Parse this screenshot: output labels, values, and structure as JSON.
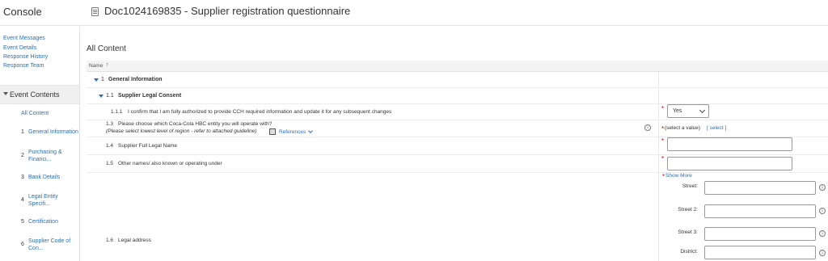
{
  "header": {
    "console_title": "Console",
    "doc_title": "Doc1024169835 - Supplier registration questionnaire"
  },
  "sidebar": {
    "links": [
      "Event Messages",
      "Event Details",
      "Response History",
      "Response Team"
    ],
    "section_label": "Event Contents",
    "all_content": "All Content",
    "toc": [
      {
        "num": "1",
        "label": "General Information"
      },
      {
        "num": "2",
        "label": "Purchasing & Financi..."
      },
      {
        "num": "3",
        "label": "Bank Details"
      },
      {
        "num": "4",
        "label": "Legal Entity Specifi..."
      },
      {
        "num": "5",
        "label": "Certification"
      },
      {
        "num": "6",
        "label": "Supplier Code of Con..."
      }
    ]
  },
  "main": {
    "title": "All Content",
    "column_name": "Name",
    "sort_indicator": "↑",
    "section1": {
      "num": "1",
      "label": "General Information"
    },
    "section11": {
      "num": "1.1",
      "label": "Supplier Legal Consent"
    },
    "q111": {
      "num": "1.1.1",
      "text": "I confirm that I am fully authorized to provide CCH required information and update it for any subsequent changes",
      "value": "Yes"
    },
    "q13": {
      "num": "1.3",
      "text": "Please choose which Coca-Cola HBC entity you will operate with?",
      "hint": "(Please select lowest level of region - refer to attached guideline)",
      "references": "References",
      "placeholder": "(select a value)",
      "select_link": "[ select ]"
    },
    "q14": {
      "num": "1.4",
      "text": "Supplier Full Legal Name"
    },
    "q15": {
      "num": "1.5",
      "text": "Other names/ also known or operating under"
    },
    "show_more": "Show More",
    "q16": {
      "num": "1.6",
      "text": "Legal address",
      "fields": [
        "Street:",
        "Street 2:",
        "Street 3:",
        "District:"
      ]
    },
    "info_glyph": "i",
    "required_glyph": "*"
  },
  "colors": {
    "link": "#2a6ebb",
    "required": "#dd0000",
    "section_bg": "#f0f0f0"
  }
}
